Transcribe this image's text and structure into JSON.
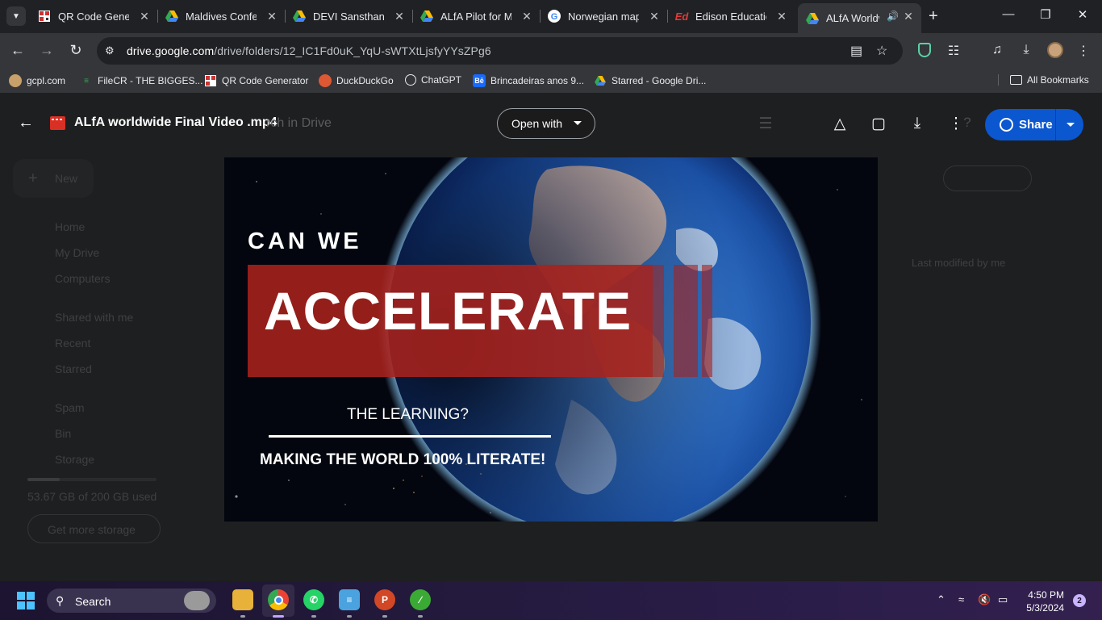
{
  "browser": {
    "tabs": [
      {
        "title": "QR Code Genera",
        "icon": "qr-code-icon"
      },
      {
        "title": "Maldives Confer",
        "icon": "google-drive-icon"
      },
      {
        "title": "DEVI Sansthan -",
        "icon": "google-drive-icon"
      },
      {
        "title": "ALfA Pilot for Ma",
        "icon": "google-drive-icon"
      },
      {
        "title": "Norwegian map",
        "icon": "google-icon"
      },
      {
        "title": "Edison Education",
        "icon": "edison-icon"
      },
      {
        "title": "ALfA Worldw",
        "icon": "google-drive-icon",
        "active": true,
        "audio": true
      }
    ],
    "url_host": "drive.google.com",
    "url_path": "/drive/folders/12_IC1Fd0uK_YqU-sWTXtLjsfyYYsZPg6",
    "bookmarks": [
      {
        "label": "gcpl.com",
        "icon": "gcpl-icon"
      },
      {
        "label": "FileCR - THE BIGGES...",
        "icon": "filecr-icon"
      },
      {
        "label": "QR Code Generator",
        "icon": "qr-code-icon"
      },
      {
        "label": "DuckDuckGo",
        "icon": "duckduckgo-icon"
      },
      {
        "label": "ChatGPT",
        "icon": "chatgpt-icon"
      },
      {
        "label": "Brincadeiras anos 9...",
        "icon": "behance-icon"
      },
      {
        "label": "Starred - Google Dri...",
        "icon": "google-drive-icon"
      }
    ],
    "all_bookmarks": "All Bookmarks"
  },
  "drive": {
    "new_label": "New",
    "nav": [
      "Home",
      "My Drive",
      "Computers",
      "Shared with me",
      "Recent",
      "Starred",
      "Spam",
      "Bin",
      "Storage"
    ],
    "storage_used": "53.67 GB of 200 GB used",
    "storage_fraction": 0.27,
    "get_more": "Get more storage",
    "search_ghost": "rch in Drive",
    "sort_label": "Last modified by me"
  },
  "preview": {
    "file_name": "ALfA worldwide Final Video .mp4",
    "open_with": "Open with",
    "share": "Share"
  },
  "video": {
    "line1": "CAN WE",
    "line2": "ACCELERATE",
    "line3": "THE LEARNING?",
    "line4": "MAKING THE WORLD 100% LITERATE!"
  },
  "taskbar": {
    "search_label": "Search",
    "time": "4:50 PM",
    "date": "5/3/2024",
    "notifications": "2"
  },
  "colors": {
    "share_blue": "#0b57d0",
    "band_red": "#a8221c",
    "win_accent": "#4cc2ff"
  }
}
